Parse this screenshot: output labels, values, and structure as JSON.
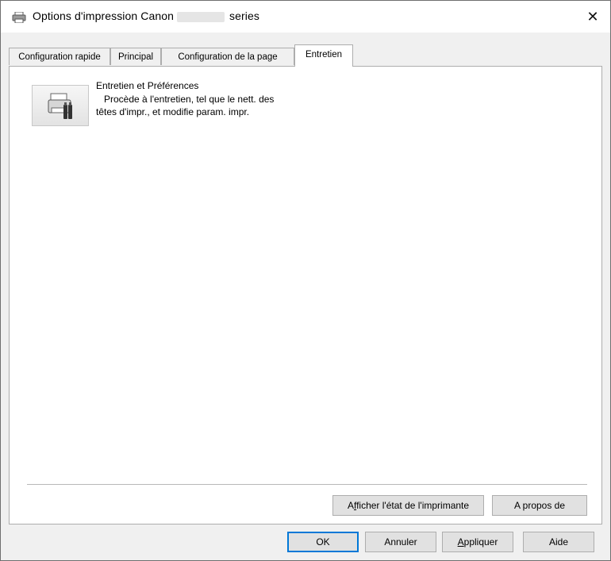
{
  "window": {
    "title_prefix": "Options d'impression Canon",
    "title_suffix": "series",
    "close_glyph": "✕"
  },
  "tabs": [
    {
      "label": "Configuration rapide",
      "active": false
    },
    {
      "label": "Principal",
      "active": false
    },
    {
      "label": "Configuration de la page",
      "active": false
    },
    {
      "label": "Entretien",
      "active": true
    }
  ],
  "maintenance": {
    "item_title": "Entretien et Préférences",
    "desc_line1": "Procède à l'entretien, tel que le nett. des",
    "desc_line2": "têtes d'impr., et modifie param. impr.",
    "icon": "printer-maintenance-icon"
  },
  "panel_buttons": {
    "printer_status_first": "A",
    "printer_status_u": "f",
    "printer_status_rest": "ficher l'état de l'imprimante",
    "about": "A propos de"
  },
  "footer": {
    "ok": "OK",
    "cancel": "Annuler",
    "apply_u": "A",
    "apply_rest": "ppliquer",
    "help": "Aide"
  },
  "colors": {
    "accent": "#0078d7",
    "button_face": "#e1e1e1",
    "dialog_bg": "#f0f0f0"
  }
}
